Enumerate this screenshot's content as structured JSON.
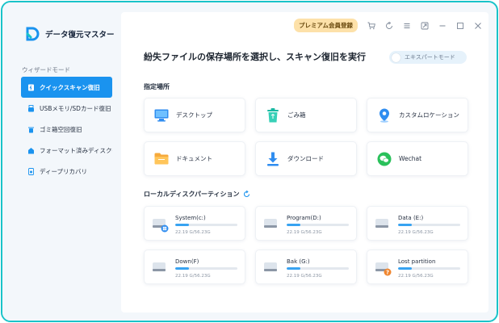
{
  "app": {
    "title": "データ復元マスター"
  },
  "sidebar": {
    "section_label": "ウィザードモード",
    "items": [
      {
        "label": "クイックスキャン復旧",
        "icon": "quick-scan-icon",
        "active": true
      },
      {
        "label": "USBメモリ/SDカード復旧",
        "icon": "usb-icon",
        "active": false
      },
      {
        "label": "ゴミ箱空回復旧",
        "icon": "trash-icon",
        "active": false
      },
      {
        "label": "フォーマット済みディスク復旧",
        "icon": "format-icon",
        "active": false
      },
      {
        "label": "ディープリカバリ",
        "icon": "deep-recovery-icon",
        "active": false
      }
    ]
  },
  "topbar": {
    "premium_label": "プレミアム会員登録",
    "icons": [
      "cart-icon",
      "refresh-icon",
      "menu-icon",
      "feedback-icon",
      "minimize-icon",
      "maximize-icon",
      "close-icon"
    ]
  },
  "main": {
    "headline": "紛失ファイルの保存場所を選択し、スキャン復旧を実行",
    "expert_mode_label": "エキスパートモード",
    "locations_title": "指定場所",
    "locations": [
      {
        "label": "デスクトップ",
        "icon": "desktop-icon"
      },
      {
        "label": "ごみ箱",
        "icon": "recycle-bin-icon"
      },
      {
        "label": "カスタムロケーション",
        "icon": "location-pin-icon"
      },
      {
        "label": "ドキュメント",
        "icon": "folder-icon"
      },
      {
        "label": "ダウンロード",
        "icon": "download-icon"
      },
      {
        "label": "Wechat",
        "icon": "wechat-icon"
      }
    ],
    "drives_title": "ローカルディスクパーティション",
    "drives": [
      {
        "name": "System(c:)",
        "size": "22.19 G/56.23G",
        "used_fraction": 0.22,
        "badge": "windows"
      },
      {
        "name": "Program(D:)",
        "size": "22.19 G/56.23G",
        "used_fraction": 0.22,
        "badge": ""
      },
      {
        "name": "Data (E:)",
        "size": "22.19 G/56.23G",
        "used_fraction": 0.22,
        "badge": ""
      },
      {
        "name": "Down(F)",
        "size": "22.19 G/56.23G",
        "used_fraction": 0.22,
        "badge": ""
      },
      {
        "name": "Bak (G:)",
        "size": "22.19 G/56.23G",
        "used_fraction": 0.22,
        "badge": ""
      },
      {
        "name": "Lost partition",
        "size": "22.19 G/56.23G",
        "used_fraction": 0.22,
        "badge": "question"
      }
    ]
  },
  "colors": {
    "accent": "#1a93ef",
    "frame_border": "#19c3c9",
    "premium_bg": "#fde1a9",
    "progress": "#38a3f1"
  }
}
